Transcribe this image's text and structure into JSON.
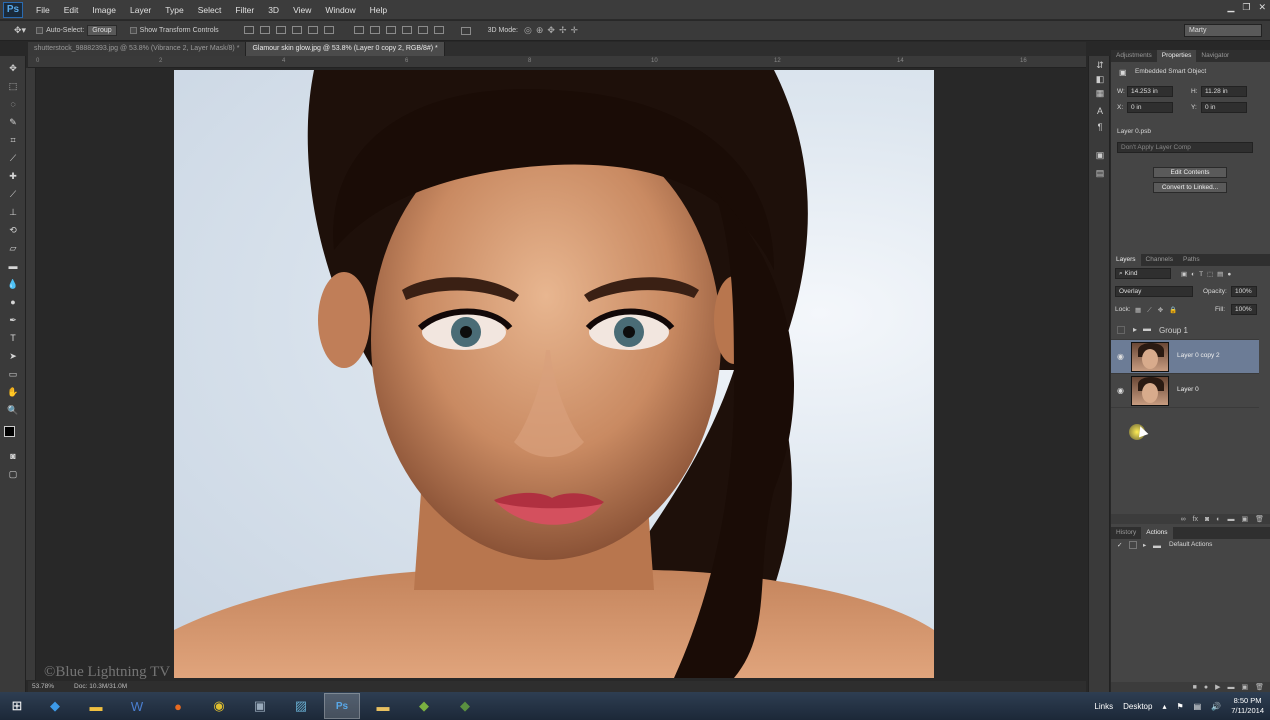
{
  "app": {
    "logo": "Ps",
    "name": "Adobe Photoshop"
  },
  "menu": [
    "File",
    "Edit",
    "Image",
    "Layer",
    "Type",
    "Select",
    "Filter",
    "3D",
    "View",
    "Window",
    "Help"
  ],
  "options_bar": {
    "auto_select_label": "Auto-Select:",
    "auto_select_value": "Group",
    "transform_label": "Show Transform Controls",
    "mode_3d_label": "3D Mode:",
    "workspace": "Marty"
  },
  "doc_tabs": [
    {
      "label": "shutterstock_98882393.jpg @ 53.8% (Vibrance 2, Layer Mask/8) *",
      "active": false
    },
    {
      "label": "Glamour skin glow.jpg @ 53.8% (Layer 0 copy 2, RGB/8#) *",
      "active": true
    }
  ],
  "ruler_ticks": [
    "0",
    "2",
    "4",
    "6",
    "8",
    "10",
    "12",
    "14",
    "16"
  ],
  "status": {
    "zoom": "53.78%",
    "doc": "Doc: 10.3M/31.0M"
  },
  "watermark": "©Blue Lightning TV",
  "properties": {
    "tabs": [
      "Adjustments",
      "Properties",
      "Navigator"
    ],
    "active_tab": "Properties",
    "title": "Embedded Smart Object",
    "w_label": "W:",
    "w_value": "14.253 in",
    "h_label": "H:",
    "h_value": "11.28 in",
    "x_label": "X:",
    "x_value": "0 in",
    "y_label": "Y:",
    "y_value": "0 in",
    "file": "Layer 0.psb",
    "comp_select": "Don't Apply Layer Comp",
    "edit_btn": "Edit Contents",
    "convert_btn": "Convert to Linked..."
  },
  "layers_panel": {
    "tabs": [
      "Layers",
      "Channels",
      "Paths"
    ],
    "kind": "Kind",
    "blend_mode": "Overlay",
    "opacity_label": "Opacity:",
    "opacity_value": "100%",
    "lock_label": "Lock:",
    "fill_label": "Fill:",
    "fill_value": "100%",
    "layers": [
      {
        "name": "Group 1",
        "type": "group",
        "selected": false
      },
      {
        "name": "Layer 0 copy 2",
        "type": "smart",
        "selected": true
      },
      {
        "name": "Layer 0",
        "type": "smart",
        "selected": false
      }
    ]
  },
  "history_panel": {
    "tabs": [
      "History",
      "Actions"
    ],
    "active_tab": "Actions",
    "item": "Default Actions"
  },
  "taskbar": {
    "apps": [
      "start-icon",
      "dropbox-icon",
      "file-explorer-icon",
      "word-icon",
      "firefox-icon",
      "chrome-icon",
      "control-panel-icon",
      "picture-viewer-icon",
      "photoshop-icon",
      "folder-icon",
      "camtasia-icon",
      "recorder-icon"
    ],
    "tray_links": "Links",
    "tray_desktop": "Desktop",
    "time": "8:50 PM",
    "date": "7/11/2014"
  }
}
